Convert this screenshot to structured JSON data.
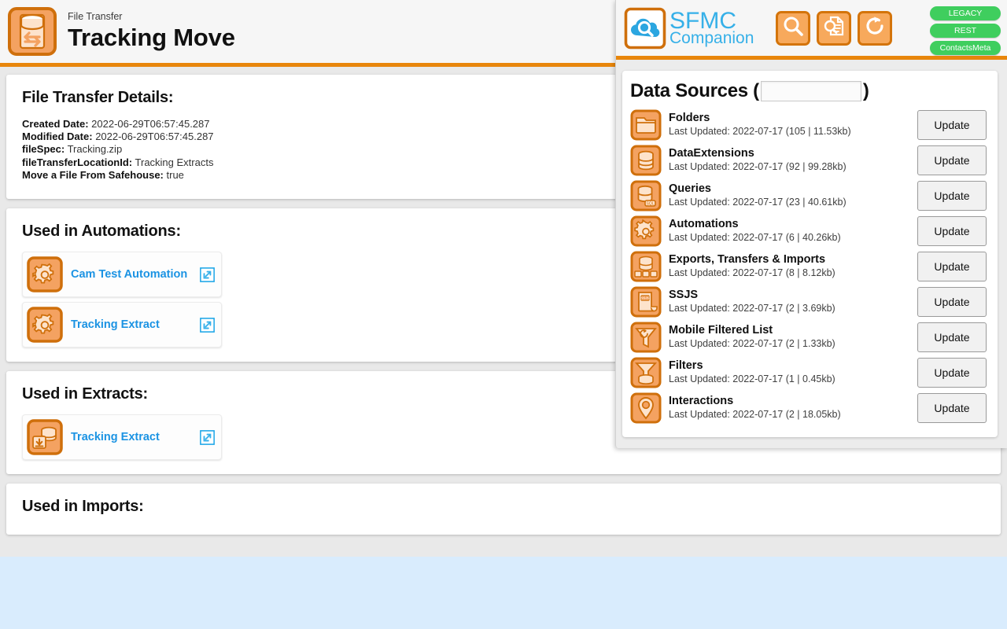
{
  "page": {
    "header": {
      "kicker": "File Transfer",
      "title": "Tracking Move",
      "icon": "file-transfer-icon"
    },
    "details_card": {
      "heading": "File Transfer Details:",
      "rows": [
        {
          "label": "Created Date:",
          "value": "2022-06-29T06:57:45.287"
        },
        {
          "label": "Modified Date:",
          "value": "2022-06-29T06:57:45.287"
        },
        {
          "label": "fileSpec:",
          "value": "Tracking.zip"
        },
        {
          "label": "fileTransferLocationId:",
          "value": "Tracking Extracts"
        },
        {
          "label": "Move a File From Safehouse:",
          "value": "true"
        }
      ]
    },
    "automations_card": {
      "heading": "Used in Automations:",
      "items": [
        {
          "label": "Cam Test Automation",
          "icon": "gear-icon",
          "link_icon": "external-link-icon"
        },
        {
          "label": "Tracking Extract",
          "icon": "gear-icon",
          "link_icon": "external-link-icon"
        }
      ]
    },
    "extracts_card": {
      "heading": "Used in Extracts:",
      "items": [
        {
          "label": "Tracking Extract",
          "icon": "data-extract-icon",
          "link_icon": "external-link-icon"
        }
      ]
    },
    "imports_card": {
      "heading": "Used in Imports:",
      "items": []
    }
  },
  "overlay": {
    "brand": {
      "line1": "SFMC",
      "line2": "Companion",
      "mark": "cloud-search-icon"
    },
    "tools": [
      {
        "name": "search-button",
        "icon": "search-icon"
      },
      {
        "name": "document-search-button",
        "icon": "document-search-icon"
      },
      {
        "name": "refresh-button",
        "icon": "refresh-icon"
      }
    ],
    "badges": [
      "LEGACY",
      "REST",
      "ContactsMeta"
    ],
    "data_sources": {
      "title_prefix": "Data Sources (",
      "title_suffix": ")",
      "filter_value": "",
      "filter_placeholder": "",
      "update_label": "Update",
      "rows": [
        {
          "name": "Folders",
          "sub": "Last Updated: 2022-07-17 (105 | 11.53kb)",
          "icon": "folder-icon"
        },
        {
          "name": "DataExtensions",
          "sub": "Last Updated: 2022-07-17 (92 | 99.28kb)",
          "icon": "database-icon"
        },
        {
          "name": "Queries",
          "sub": "Last Updated: 2022-07-17 (23 | 40.61kb)",
          "icon": "sql-database-icon"
        },
        {
          "name": "Automations",
          "sub": "Last Updated: 2022-07-17 (6 | 40.26kb)",
          "icon": "gear-icon"
        },
        {
          "name": "Exports, Transfers & Imports",
          "sub": "Last Updated: 2022-07-17 (8 | 8.12kb)",
          "icon": "transfer-icon"
        },
        {
          "name": "SSJS",
          "sub": "Last Updated: 2022-07-17 (2 | 3.69kb)",
          "icon": "script-icon"
        },
        {
          "name": "Mobile Filtered List",
          "sub": "Last Updated: 2022-07-17 (2 | 1.33kb)",
          "icon": "mobile-filter-icon"
        },
        {
          "name": "Filters",
          "sub": "Last Updated: 2022-07-17 (1 | 0.45kb)",
          "icon": "filter-icon"
        },
        {
          "name": "Interactions",
          "sub": "Last Updated: 2022-07-17 (2 | 18.05kb)",
          "icon": "pin-icon"
        }
      ]
    }
  },
  "colors": {
    "accent_orange": "#e8860c",
    "icon_orange": "#f7a95c",
    "icon_border": "#d4740a",
    "link_blue": "#1b93e3",
    "brand_blue": "#36b0e8",
    "badge_green": "#3fce5e",
    "page_bg": "#e9e9e9",
    "desktop_bg": "#d9ecfd"
  }
}
